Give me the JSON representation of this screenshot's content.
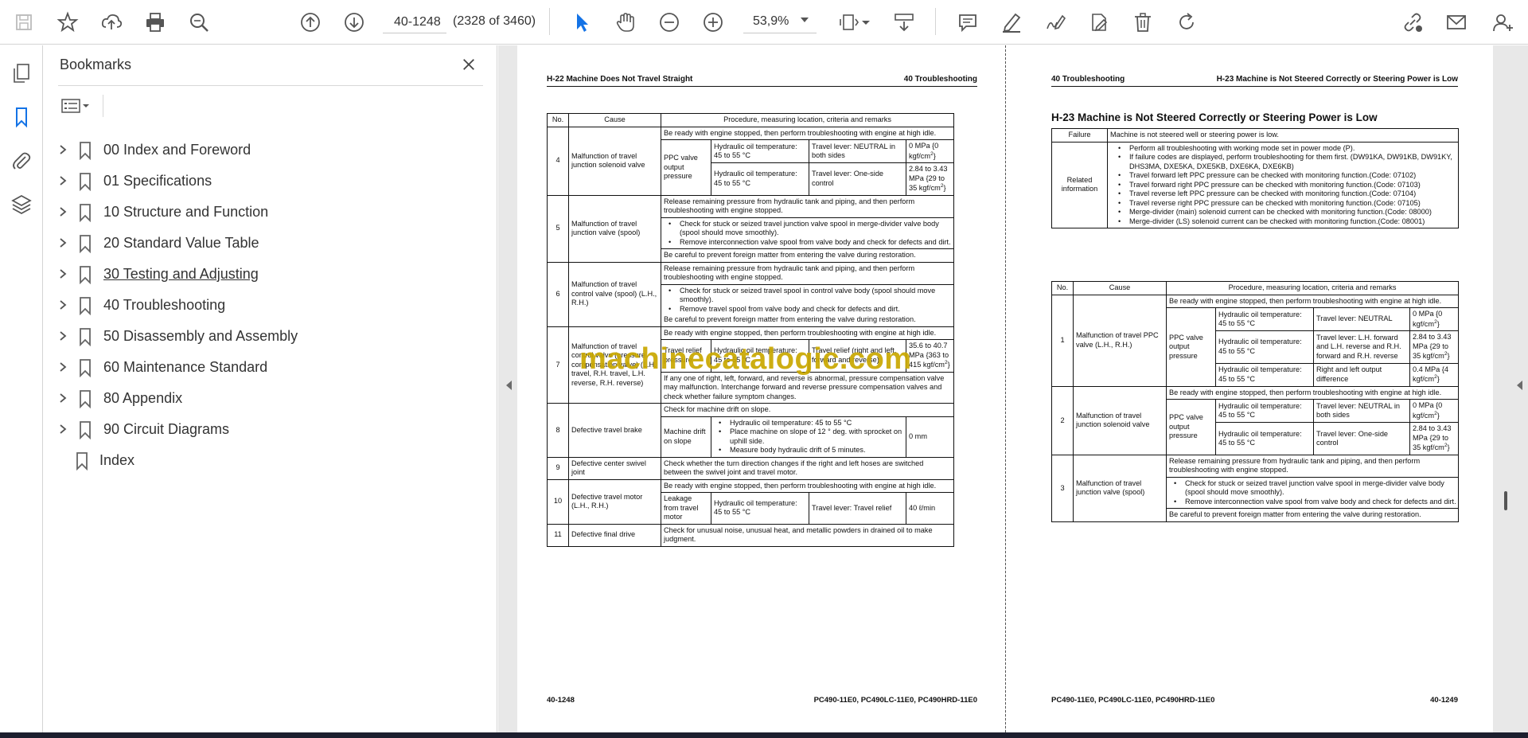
{
  "toolbar": {
    "icons": [
      "save-icon",
      "bookmark-star-icon",
      "upload-icon",
      "print-icon",
      "search-zoom-icon",
      "page-up-icon",
      "page-down-icon",
      "select-arrow-icon",
      "hand-icon",
      "zoom-out-icon",
      "zoom-in-icon",
      "fit-page-icon",
      "scroll-mode-icon",
      "comment-icon",
      "highlight-pen-icon",
      "sign-icon",
      "edit-pdf-icon",
      "delete-icon",
      "rotate-icon",
      "link-share-icon",
      "email-icon",
      "account-icon"
    ],
    "page_value": "40-1248",
    "page_count": "(2328 of 3460)",
    "zoom": "53,9%"
  },
  "bookmarks": {
    "title": "Bookmarks",
    "items": [
      {
        "label": "00 Index and Foreword",
        "expandable": true
      },
      {
        "label": "01 Specifications",
        "expandable": true
      },
      {
        "label": "10 Structure and Function",
        "expandable": true
      },
      {
        "label": "20 Standard Value Table",
        "expandable": true
      },
      {
        "label": "30 Testing and Adjusting",
        "expandable": true
      },
      {
        "label": "40 Troubleshooting",
        "expandable": true
      },
      {
        "label": "50 Disassembly and Assembly",
        "expandable": true
      },
      {
        "label": "60 Maintenance Standard",
        "expandable": true
      },
      {
        "label": "80 Appendix",
        "expandable": true
      },
      {
        "label": "90 Circuit Diagrams",
        "expandable": true
      },
      {
        "label": "Index",
        "expandable": false
      }
    ]
  },
  "left_page": {
    "header_left": "H-22 Machine Does Not Travel Straight",
    "header_right": "40 Troubleshooting",
    "footer_left": "40-1248",
    "footer_right": "PC490-11E0, PC490LC-11E0, PC490HRD-11E0",
    "col_no": "No.",
    "col_cause": "Cause",
    "col_proc": "Procedure, measuring location, criteria and remarks",
    "r4": {
      "no": "4",
      "cause": "Malfunction of travel junction solenoid valve",
      "intro": "Be ready with engine stopped, then perform troubleshooting with engine at high idle.",
      "item": "PPC valve output pressure",
      "cond1": "Hydraulic oil temperature: 45 to 55 °C",
      "lever1": "Travel lever: NEUTRAL in both sides",
      "val1": "0 MPa {0 kgf/cm",
      "val1b": "}",
      "cond2": "Hydraulic oil temperature: 45 to 55 °C",
      "lever2": "Travel lever: One-side control",
      "val2": "2.84 to 3.43 MPa {29 to 35 kgf/cm",
      "val2b": "}"
    },
    "r5": {
      "no": "5",
      "cause": "Malfunction of travel junction valve (spool)",
      "intro": "Release remaining pressure from hydraulic tank and piping, and then perform troubleshooting with engine stopped.",
      "b1": "Check for stuck or seized travel junction valve spool in merge-divider valve body (spool should move smoothly).",
      "b2": "Remove interconnection valve spool from valve body and check for defects and dirt.",
      "outro": "Be careful to prevent foreign matter from entering the valve during restoration."
    },
    "r6": {
      "no": "6",
      "cause": "Malfunction of travel control valve (spool) (L.H., R.H.)",
      "intro": "Release remaining pressure from hydraulic tank and piping, and then perform troubleshooting with engine stopped.",
      "b1": "Check for stuck or seized travel spool in control valve body (spool should move smoothly).",
      "b2": "Remove travel spool from valve body and check for defects and dirt.",
      "outro": "Be careful to prevent foreign matter from entering the valve during restoration."
    },
    "r7": {
      "no": "7",
      "cause": "Malfunction of travel control valve (pressure compensation valve) (L.H. travel, R.H. travel, L.H. reverse, R.H. reverse)",
      "intro": "Be ready with engine stopped, then perform troubleshooting with engine at high idle.",
      "item": "Travel relief pressure",
      "cond": "Hydraulic oil temperature: 45 to 55 °C",
      "lever": "Travel relief (right and left, forward and reverse)",
      "val": "35.6 to 40.7 MPa {363 to 415 kgf/cm",
      "valb": "}",
      "outro": "If any one of right, left, forward, and reverse is abnormal, pressure compensation valve may malfunction. Interchange forward and reverse pressure compensation valves and check whether failure symptom changes."
    },
    "r8": {
      "no": "8",
      "cause": "Defective travel brake",
      "intro": "Check for machine drift on slope.",
      "item": "Machine drift on slope",
      "b1": "Hydraulic oil temperature: 45 to 55 °C",
      "b2": "Place machine on slope of 12 ° deg. with sprocket on uphill side.",
      "b3": "Measure body hydraulic drift of 5 minutes.",
      "val": "0 mm"
    },
    "r9": {
      "no": "9",
      "cause": "Defective center swivel joint",
      "text": "Check whether the turn direction changes if the right and left hoses are switched between the swivel joint and travel motor."
    },
    "r10": {
      "no": "10",
      "cause": "Defective travel motor (L.H., R.H.)",
      "intro": "Be ready with engine stopped, then perform troubleshooting with engine at high idle.",
      "item": "Leakage from travel motor",
      "cond": "Hydraulic oil temperature: 45 to 55 °C",
      "lever": "Travel lever: Travel relief",
      "val": "40 ℓ/min"
    },
    "r11": {
      "no": "11",
      "cause": "Defective final drive",
      "text": "Check for unusual noise, unusual heat, and metallic powders in drained oil to make judgment."
    }
  },
  "right_page": {
    "header_left": "40 Troubleshooting",
    "header_right": "H-23 Machine is Not Steered Correctly or Steering Power is Low",
    "title": "H-23 Machine is Not Steered Correctly or Steering Power is Low",
    "footer_left": "PC490-11E0, PC490LC-11E0, PC490HRD-11E0",
    "footer_right": "40-1249",
    "failure_label": "Failure",
    "failure_text": "Machine is not steered well or steering power is low.",
    "related_label": "Related information",
    "related": [
      "Perform all troubleshooting with working mode set in power mode (P).",
      "If failure codes are displayed, perform troubleshooting for them first. (DW91KA, DW91KB, DW91KY, DHS3MA, DXE5KA, DXE5KB, DXE6KA, DXE6KB)",
      "Travel forward left PPC pressure can be checked with monitoring function.(Code: 07102)",
      "Travel forward right PPC pressure can be checked with monitoring function.(Code: 07103)",
      "Travel reverse left PPC pressure can be checked with monitoring function.(Code: 07104)",
      "Travel reverse right PPC pressure can be checked with monitoring function.(Code: 07105)",
      "Merge-divider (main) solenoid current can be checked with monitoring function.(Code: 08000)",
      "Merge-divider (LS) solenoid current can be checked with monitoring function.(Code: 08001)"
    ],
    "col_no": "No.",
    "col_cause": "Cause",
    "col_proc": "Procedure, measuring location, criteria and remarks",
    "r1": {
      "no": "1",
      "cause": "Malfunction of travel PPC valve (L.H., R.H.)",
      "intro": "Be ready with engine stopped, then perform troubleshooting with engine at high idle.",
      "item": "PPC valve output pressure",
      "cond1": "Hydraulic oil temperature: 45 to 55 °C",
      "lever1": "Travel lever: NEUTRAL",
      "val1": "0 MPa {0 kgf/cm",
      "val1b": "}",
      "cond2": "Hydraulic oil temperature: 45 to 55 °C",
      "lever2": "Travel lever: L.H. forward and L.H. reverse and R.H. forward and R.H. reverse",
      "val2": "2.84 to 3.43 MPa {29 to 35 kgf/cm",
      "val2b": "}",
      "cond3": "Hydraulic oil temperature: 45 to 55 °C",
      "lever3": "Right and left output difference",
      "val3": "0.4 MPa {4 kgf/cm",
      "val3b": "}"
    },
    "r2": {
      "no": "2",
      "cause": "Malfunction of travel junction solenoid valve",
      "intro": "Be ready with engine stopped, then perform troubleshooting with engine at high idle.",
      "item": "PPC valve output pressure",
      "cond1": "Hydraulic oil temperature: 45 to 55 °C",
      "lever1": "Travel lever: NEUTRAL in both sides",
      "val1": "0 MPa {0 kgf/cm",
      "val1b": "}",
      "cond2": "Hydraulic oil temperature: 45 to 55 °C",
      "lever2": "Travel lever: One-side control",
      "val2": "2.84 to 3.43 MPa {29 to 35 kgf/cm",
      "val2b": "}"
    },
    "r3": {
      "no": "3",
      "cause": "Malfunction of travel junction valve (spool)",
      "intro": "Release remaining pressure from hydraulic tank and piping, and then perform troubleshooting with engine stopped.",
      "b1": "Check for stuck or seized travel junction valve spool in merge-divider valve body (spool should move smoothly).",
      "b2": "Remove interconnection valve spool from valve body and check for defects and dirt.",
      "outro": "Be careful to prevent foreign matter from entering the valve during restoration."
    }
  },
  "watermark": "machinecatalogic.com"
}
